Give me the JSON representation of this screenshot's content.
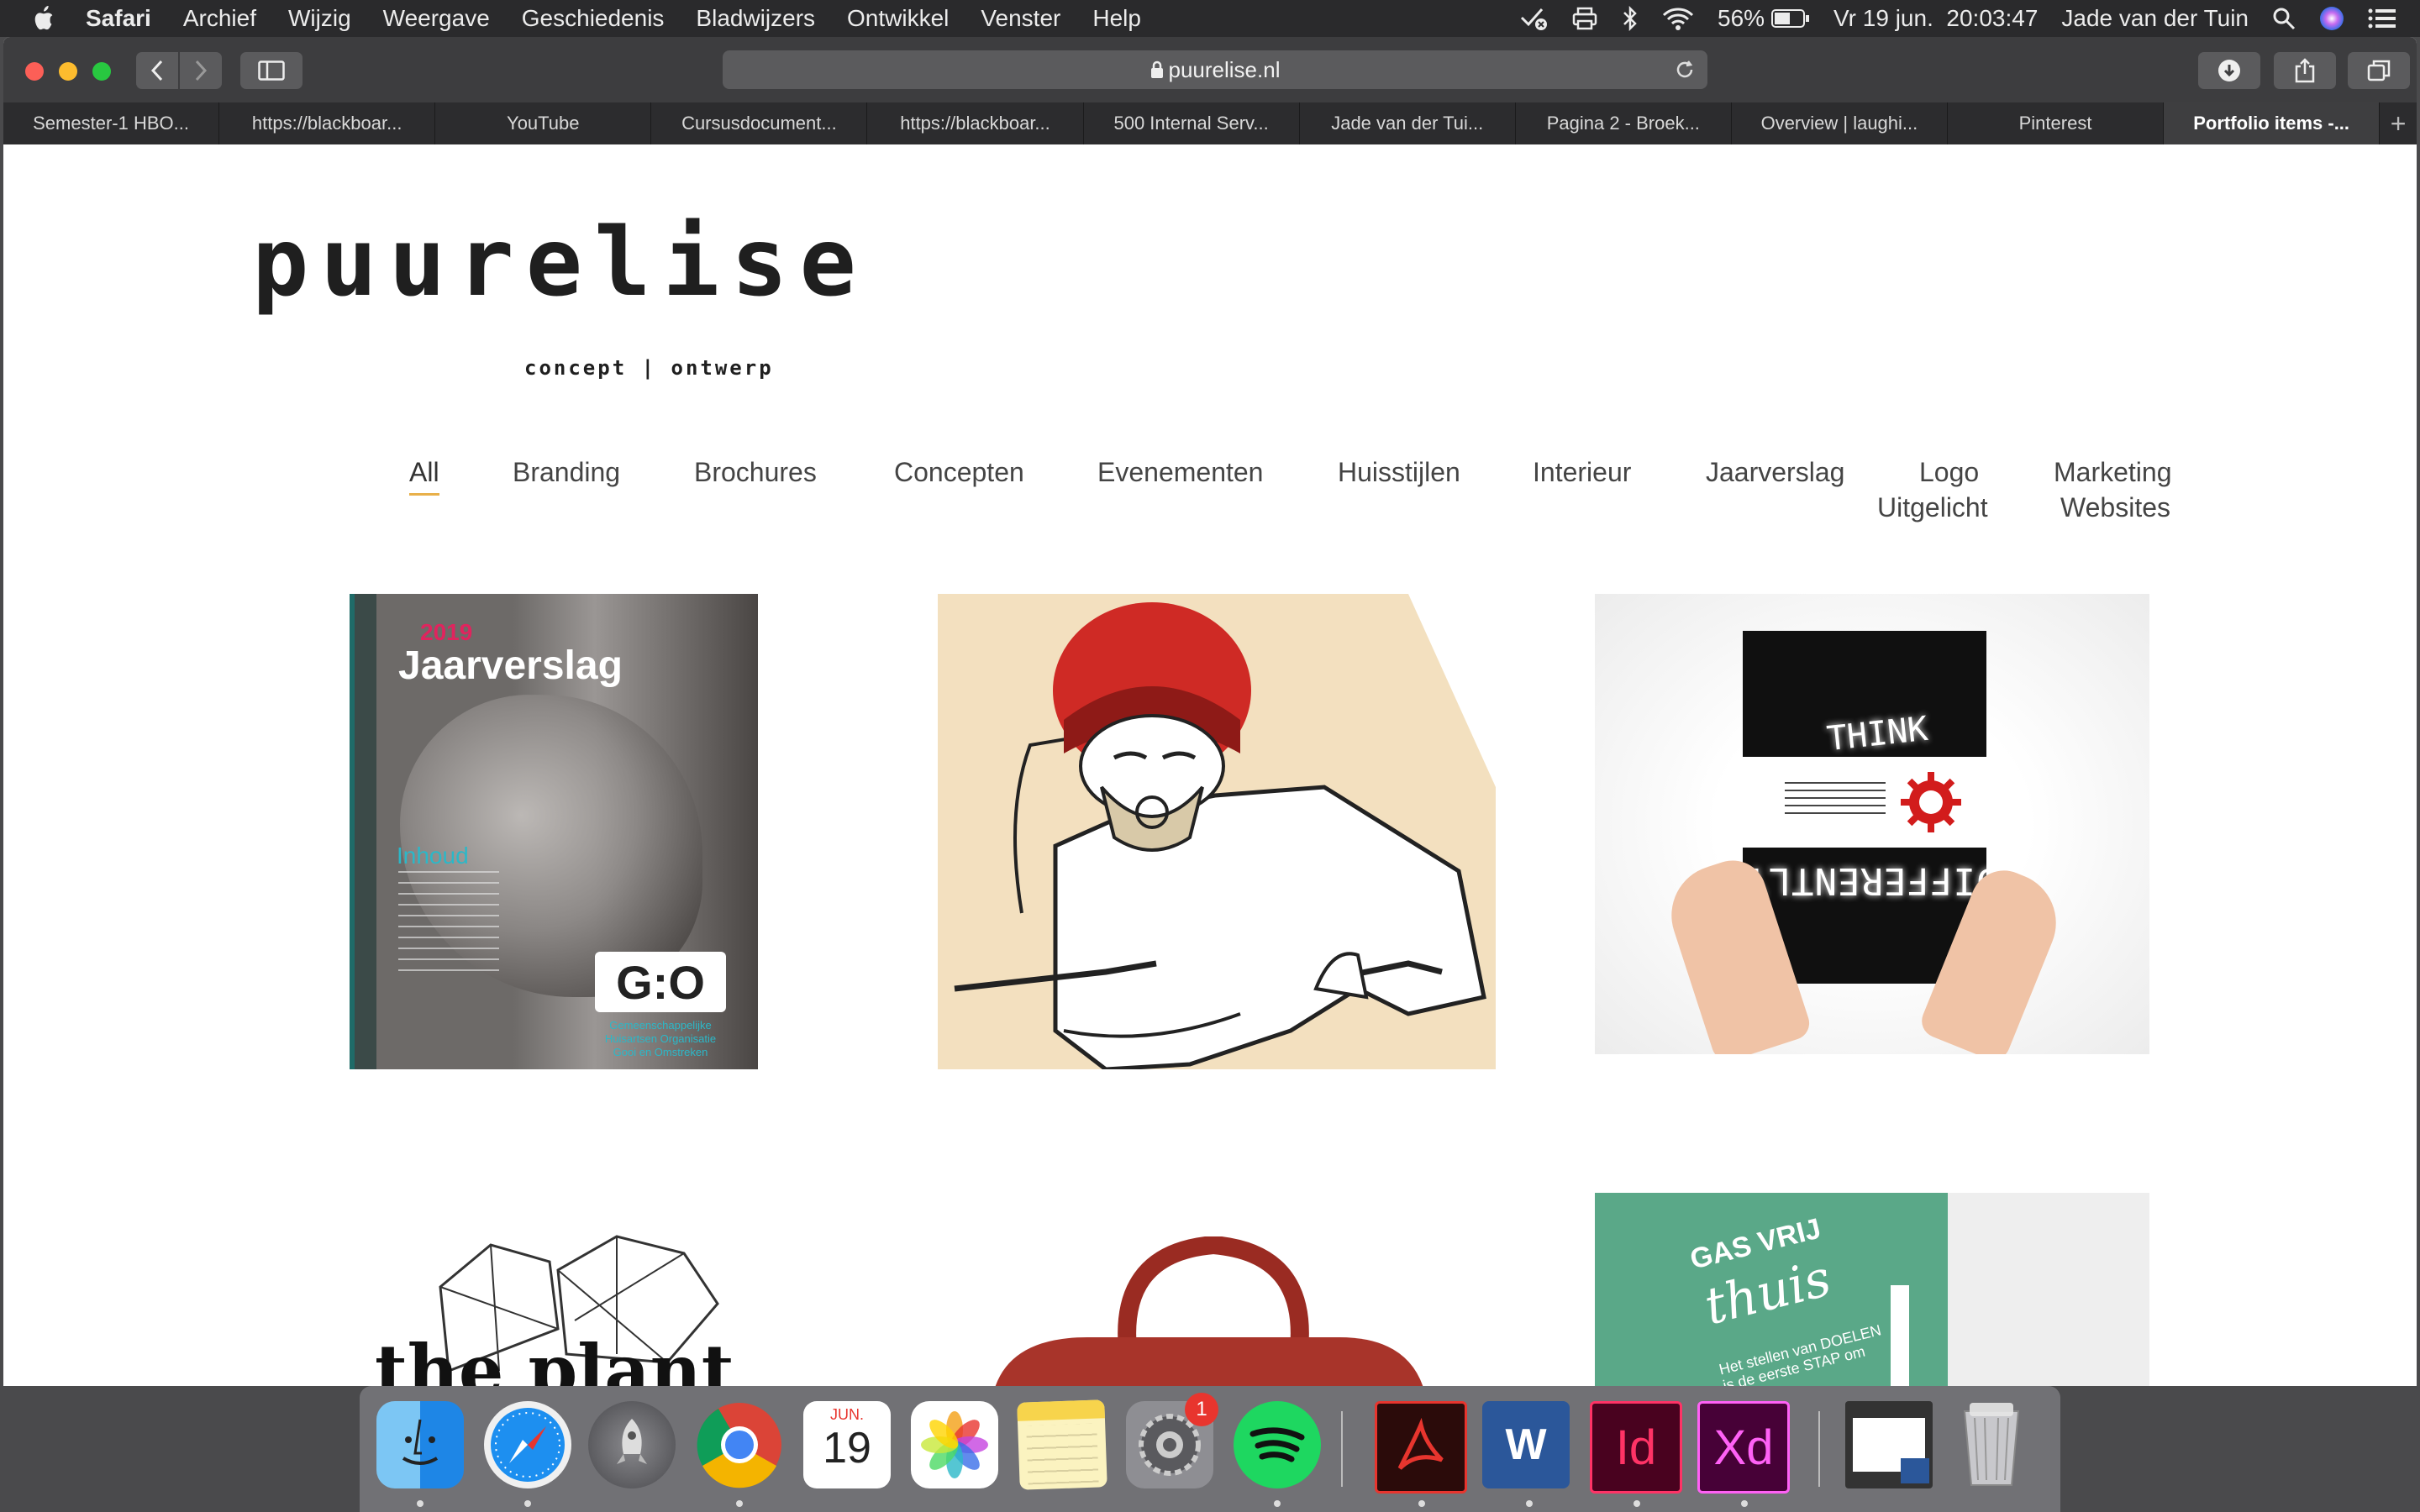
{
  "menubar": {
    "app": "Safari",
    "items": [
      "Archief",
      "Wijzig",
      "Weergave",
      "Geschiedenis",
      "Bladwijzers",
      "Ontwikkel",
      "Venster",
      "Help"
    ],
    "battery": "56%",
    "datetime": "Vr 19 jun.  20:03:47",
    "user": "Jade van der Tuin"
  },
  "browser": {
    "url": "puurelise.nl",
    "tabs": [
      "Semester-1 HBO...",
      "https://blackboar...",
      "YouTube",
      "Cursusdocument...",
      "https://blackboar...",
      "500 Internal Serv...",
      "Jade van der Tui...",
      "Pagina 2 - Broek...",
      "Overview | laughi...",
      "Pinterest",
      "Portfolio items -..."
    ],
    "active_tab": 10
  },
  "site": {
    "logo": "puurelise",
    "tagline": "concept | ontwerp",
    "filters": [
      "All",
      "Branding",
      "Brochures",
      "Concepten",
      "Evenementen",
      "Huisstijlen",
      "Interieur",
      "Jaarverslag",
      "Logo",
      "Marketing",
      "Uitgelicht",
      "Websites"
    ],
    "active_filter": "All",
    "portfolio": {
      "jaarverslag": {
        "year": "2019",
        "title": "Jaarverslag",
        "inhoud": "Inhoud",
        "brand": "G:O",
        "org": "Gemeenschappelijke Huisartsen Organisatie Gooi en Omstreken"
      },
      "think": {
        "top": "THINK",
        "bottom": "DIFFERENTLY"
      },
      "gasvrij": {
        "title": "GAS VRIJ",
        "sub": "thuis",
        "text": "Het stellen van DOELEN is de eerste STAP om het"
      },
      "plant": {
        "text": "the plant"
      }
    }
  },
  "dock": {
    "calendar_month": "JUN.",
    "calendar_day": "19",
    "badge": "1",
    "id_label": "Id",
    "xd_label": "Xd",
    "word_label": "W"
  },
  "colors": {
    "accent": "#e8b04a",
    "page_bg": "#ffffff"
  }
}
